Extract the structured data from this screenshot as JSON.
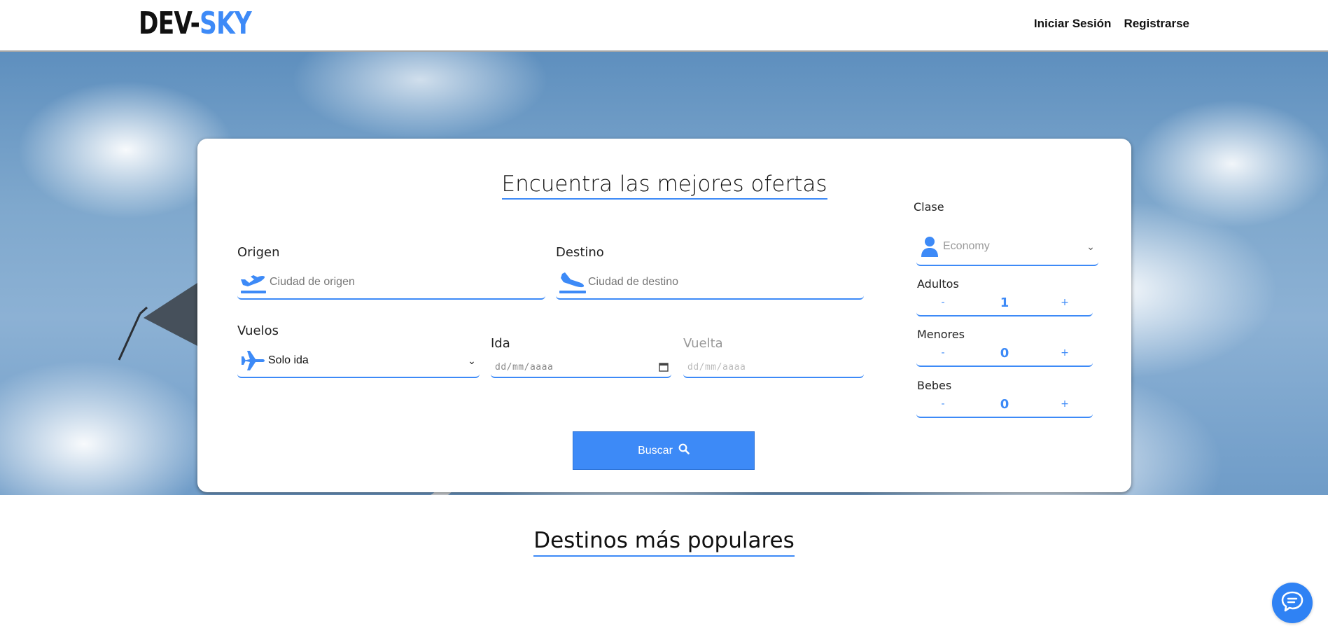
{
  "header": {
    "logo_part1": "DEV-",
    "logo_part2": "SKY",
    "nav": {
      "login": "Iniciar Sesión",
      "register": "Registrarse"
    }
  },
  "search": {
    "title": "Encuentra las mejores ofertas",
    "origin": {
      "label": "Origen",
      "placeholder": "Ciudad de origen"
    },
    "destination": {
      "label": "Destino",
      "placeholder": "Ciudad de destino"
    },
    "flights": {
      "label": "Vuelos",
      "selected": "Solo ida"
    },
    "departure": {
      "label": "Ida",
      "placeholder": "dd/mm/aaaa"
    },
    "return": {
      "label": "Vuelta",
      "placeholder": "dd/mm/aaaa"
    },
    "class": {
      "label": "Clase",
      "selected": "Economy"
    },
    "adults": {
      "label": "Adultos",
      "value": "1"
    },
    "minors": {
      "label": "Menores",
      "value": "0"
    },
    "babies": {
      "label": "Bebes",
      "value": "0"
    },
    "minus": "-",
    "plus": "+",
    "button": "Buscar"
  },
  "popular": {
    "title": "Destinos más populares"
  },
  "colors": {
    "accent": "#3d8af7",
    "text": "#111111"
  },
  "icons": [
    "plane-takeoff-icon",
    "plane-landing-icon",
    "airplane-icon",
    "user-icon",
    "calendar-icon",
    "search-icon",
    "chat-icon",
    "chevron-down-icon"
  ]
}
